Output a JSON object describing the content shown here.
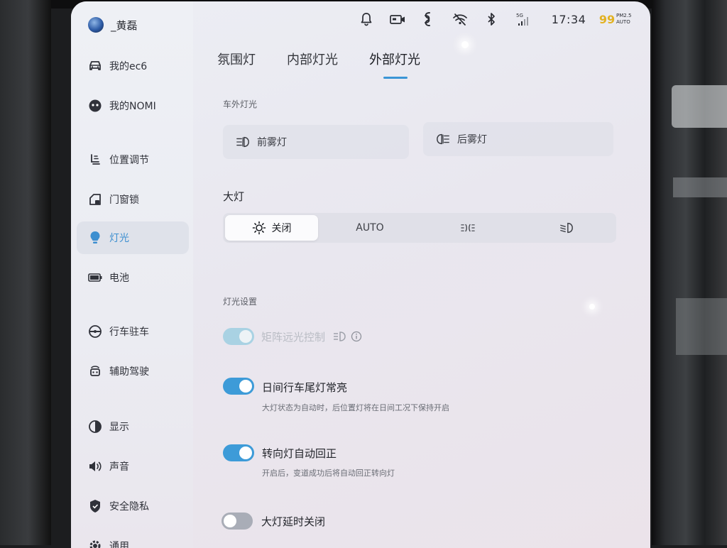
{
  "profile": {
    "name": "_黄磊"
  },
  "status": {
    "time": "17:34",
    "signal": "5G",
    "aqi_value": "99",
    "aqi_label_top": "PM2.5",
    "aqi_label_bottom": "AUTO"
  },
  "sidebar": {
    "items": [
      {
        "label": "我的ec6",
        "icon": "car-icon"
      },
      {
        "label": "我的NOMI",
        "icon": "nomi-icon"
      },
      {
        "label": "位置调节",
        "icon": "seat-icon"
      },
      {
        "label": "门窗锁",
        "icon": "door-icon"
      },
      {
        "label": "灯光",
        "icon": "bulb-icon",
        "active": true
      },
      {
        "label": "电池",
        "icon": "battery-icon"
      },
      {
        "label": "行车驻车",
        "icon": "steering-wheel-icon"
      },
      {
        "label": "辅助驾驶",
        "icon": "assist-drive-icon"
      },
      {
        "label": "显示",
        "icon": "contrast-icon"
      },
      {
        "label": "声音",
        "icon": "speaker-icon"
      },
      {
        "label": "安全隐私",
        "icon": "shield-icon"
      },
      {
        "label": "通用",
        "icon": "gear-icon"
      }
    ]
  },
  "tabs": [
    {
      "label": "氛围灯"
    },
    {
      "label": "内部灯光"
    },
    {
      "label": "外部灯光",
      "active": true
    }
  ],
  "exterior": {
    "section_title": "车外灯光",
    "front_fog": "前雾灯",
    "rear_fog": "后雾灯"
  },
  "headlight": {
    "title": "大灯",
    "options": [
      "关闭",
      "AUTO",
      "",
      ""
    ],
    "selected": "关闭"
  },
  "light_settings": {
    "section_title": "灯光设置",
    "matrix": {
      "label": "矩阵远光控制",
      "state": "disabled-on"
    },
    "drl": {
      "label": "日间行车尾灯常亮",
      "desc": "大灯状态为自动时，后位置灯将在日间工况下保持开启",
      "state": "on"
    },
    "turn": {
      "label": "转向灯自动回正",
      "desc": "开启后，变道成功后将自动回正转向灯",
      "state": "on"
    },
    "delay": {
      "label": "大灯延时关闭",
      "state": "off"
    }
  },
  "colors": {
    "accent": "#3d9bd8",
    "toggle_off": "#a9adb7",
    "aqi": "#e2b222"
  }
}
